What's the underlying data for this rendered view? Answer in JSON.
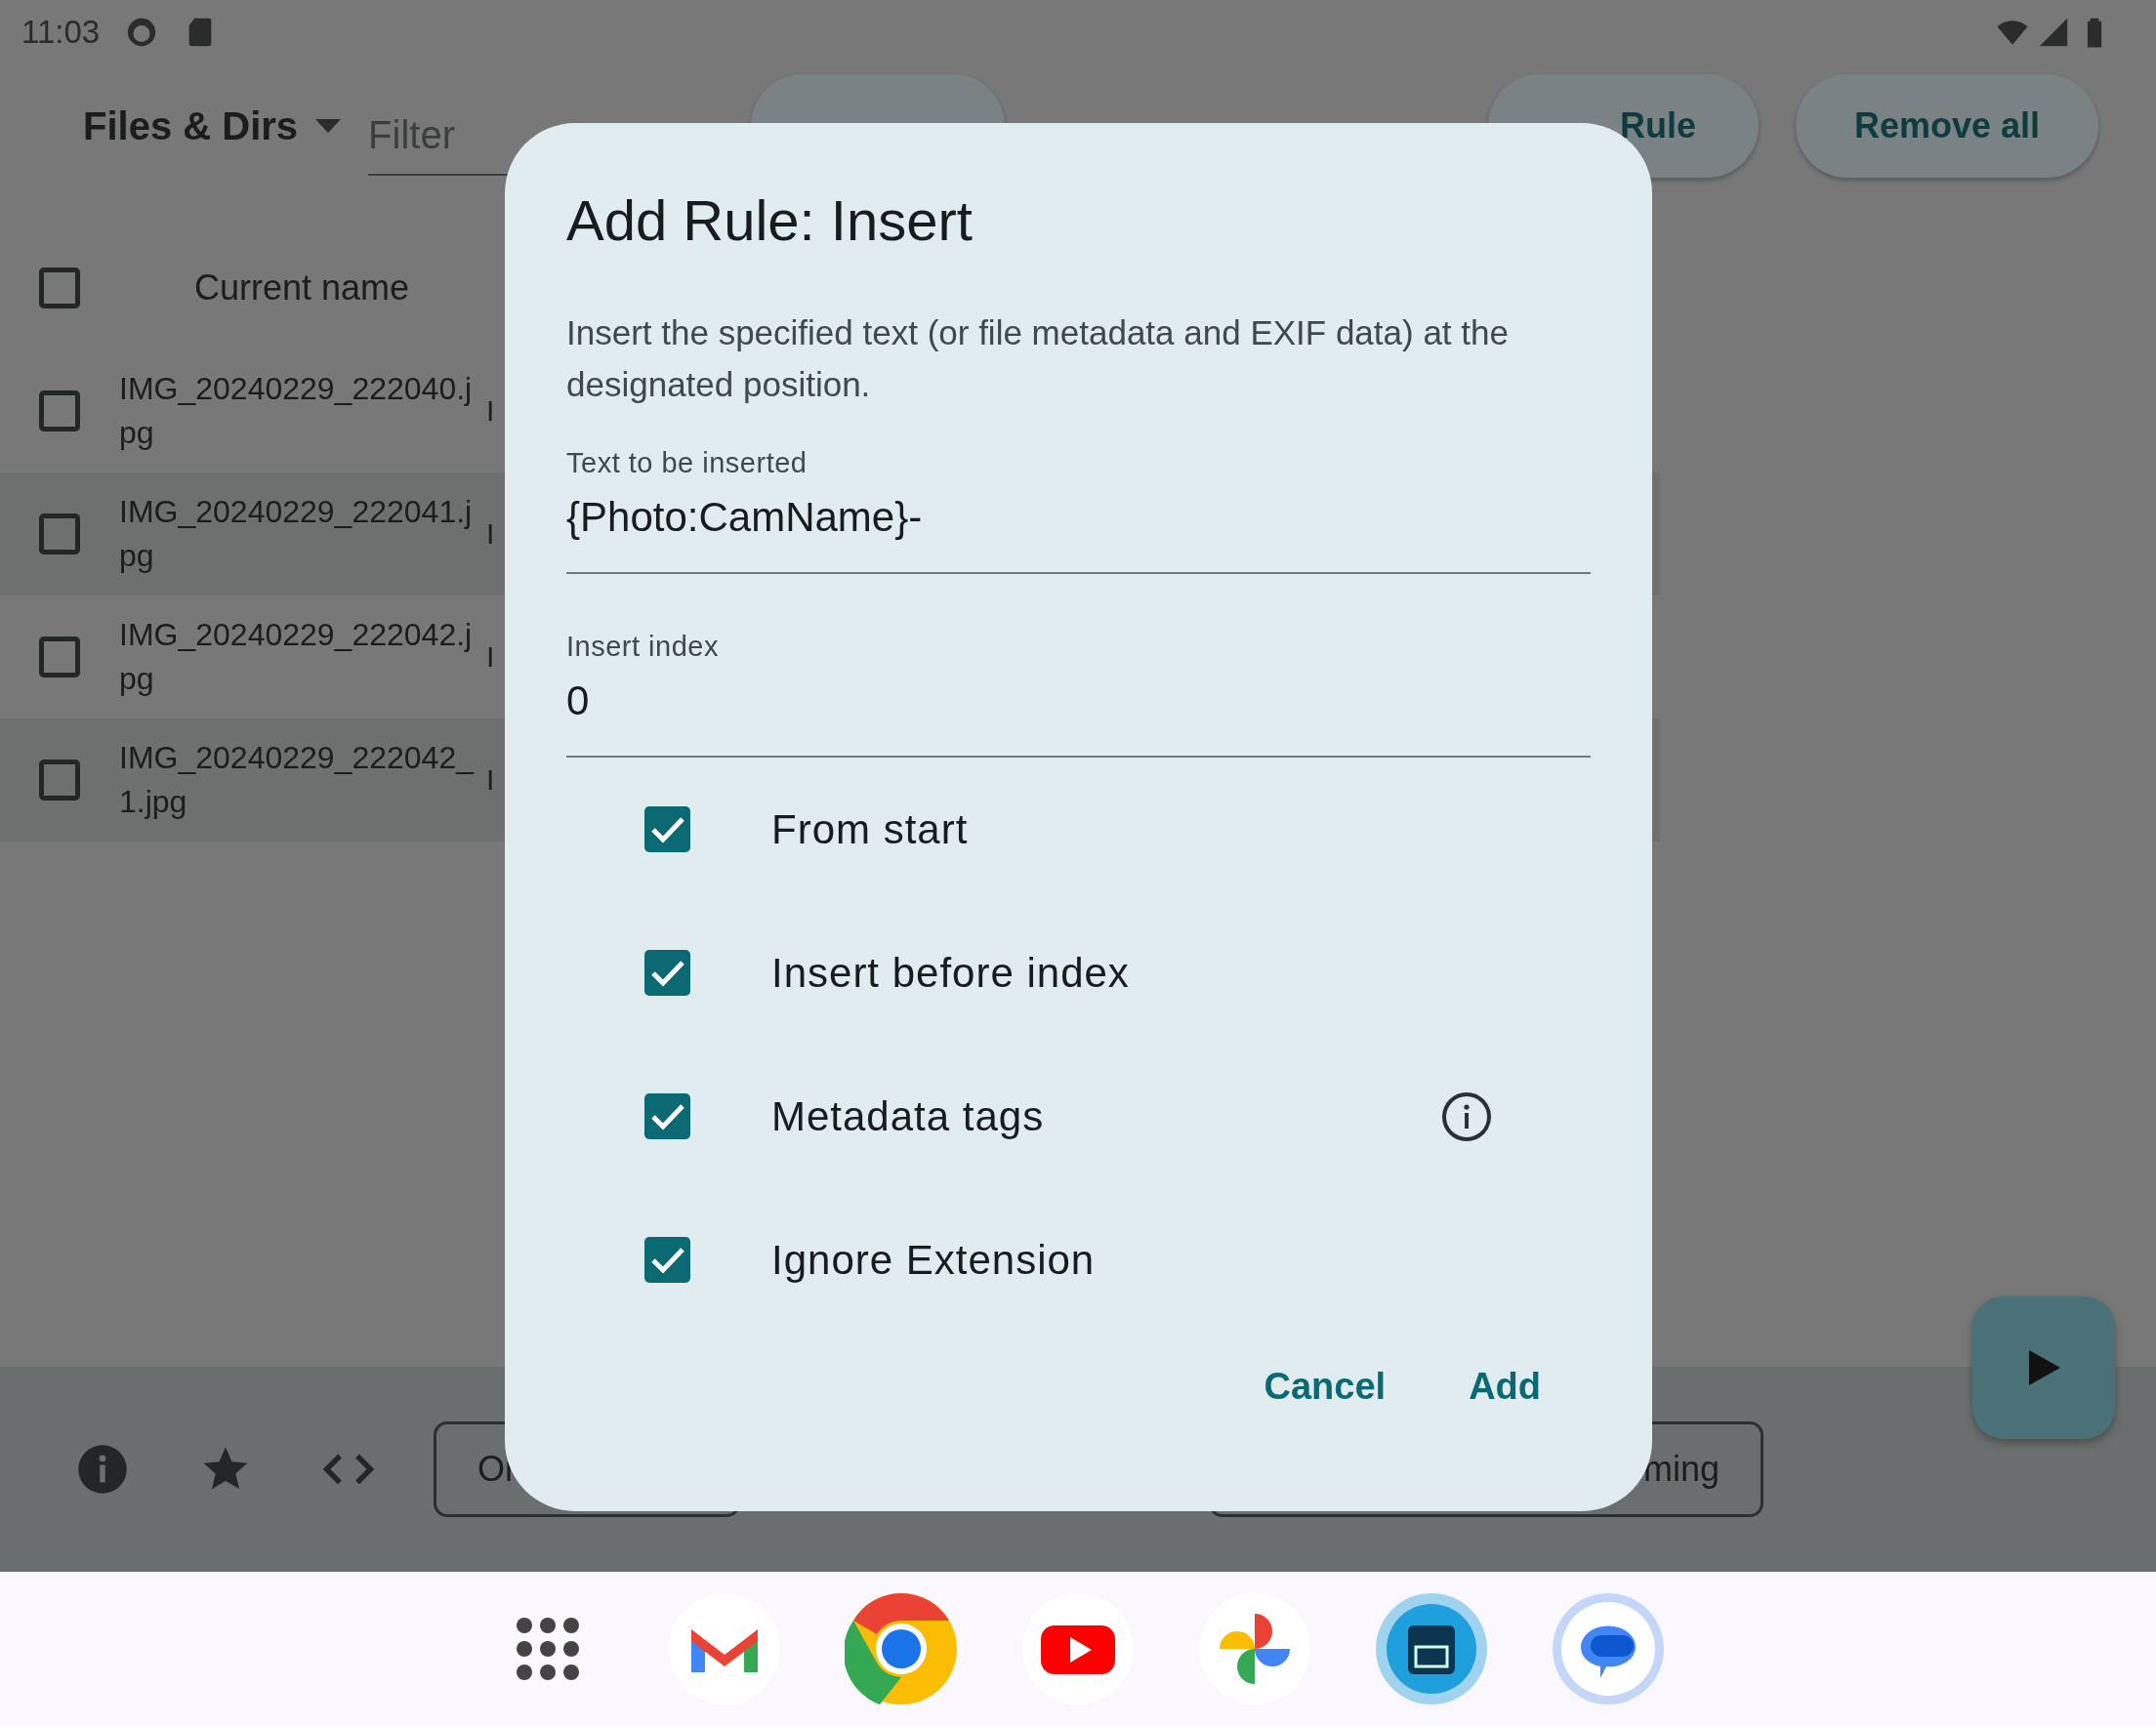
{
  "status_bar": {
    "time": "11:03"
  },
  "top_bar": {
    "source": "Files & Dirs",
    "filter": {
      "placeholder": "Filter"
    },
    "items": [
      {
        "kind": "button"
      },
      {
        "kind": "button",
        "label": "Rule"
      },
      {
        "kind": "button",
        "label": "Remove all"
      }
    ]
  },
  "table": {
    "header": {
      "checked": false,
      "label": "Current name"
    },
    "rows": [
      {
        "checked": false,
        "name": "IMG_20240229_222040.jpg",
        "column_2": "I"
      },
      {
        "checked": false,
        "name": "IMG_20240229_222041.jpg",
        "column_2": "I"
      },
      {
        "checked": false,
        "name": "IMG_20240229_222042.jpg",
        "column_2": "I"
      },
      {
        "checked": false,
        "name": "IMG_20240229_222042_1.jpg",
        "column_2": "I"
      }
    ]
  },
  "bottom_bar": {
    "buttons": [
      "Or",
      "ming"
    ]
  },
  "dialog": {
    "title": "Add Rule: Insert",
    "description": "Insert the specified text (or file metadata and EXIF data) at the designated position.",
    "fields": [
      {
        "label": "Text to be inserted",
        "value": "{Photo:CamName}-"
      },
      {
        "label": "Insert index",
        "value": "0"
      }
    ],
    "options": [
      {
        "label": "From start",
        "checked": true,
        "info": false
      },
      {
        "label": "Insert before index",
        "checked": true,
        "info": false
      },
      {
        "label": "Metadata tags",
        "checked": true,
        "info": true
      },
      {
        "label": "Ignore Extension",
        "checked": true,
        "info": false
      }
    ],
    "actions": [
      "Cancel",
      "Add"
    ]
  }
}
